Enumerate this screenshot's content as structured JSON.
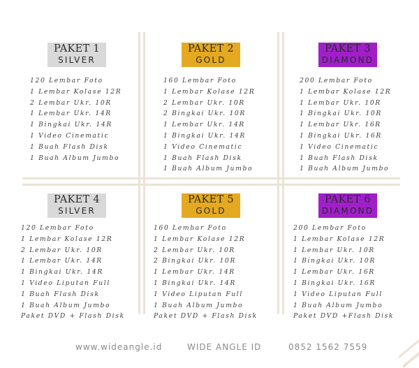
{
  "packages": [
    {
      "name": "PAKET 1",
      "tier": "SILVER",
      "items": [
        "120 Lembar Foto",
        "1 Lembar Kolase 12R",
        "2 Lembar Ukr. 10R",
        "1 Lembar Ukr. 14R",
        "1 Bingkai Ukr. 14R",
        "1 Video Cinematic",
        "1 Buah Flash Disk",
        "1 Buah Album Jumbo"
      ]
    },
    {
      "name": "PAKET 2",
      "tier": "GOLD",
      "items": [
        "160 Lembar Foto",
        "1 Lembar Kolase 12R",
        "2 Lembar Ukr. 10R",
        "2 Bingkai Ukr. 10R",
        "1 Lembar Ukr. 14R",
        "1 Bingkai Ukr. 14R",
        "1 Video Cinematic",
        "1 Buah Flash Disk",
        "1 Buah Album Jumbo"
      ]
    },
    {
      "name": "PAKET 3",
      "tier": "DIAMOND",
      "items": [
        "200 Lembar Foto",
        "1 Lembar Kolase 12R",
        "1 Lembar Ukr. 10R",
        "1 Bingkai Ukr. 10R",
        "1 Lembar Ukr. 16R",
        "1 Bingkai Ukr. 16R",
        "1 Video Cinematic",
        "1 Buah Flash Disk",
        "1 Buah Album Jumbo"
      ]
    },
    {
      "name": "PAKET 4",
      "tier": "SILVER",
      "items": [
        "120 Lembar Foto",
        "1 Lembar Kolase 12R",
        "2 Lembar Ukr. 10R",
        "1 Lembar Ukr. 14R",
        "1 Bingkai Ukr. 14R",
        "1 Video Liputan Full",
        "1 Buah Flash Disk",
        "1 Buah Album Jumbo",
        "Paket DVD + Flash Disk"
      ]
    },
    {
      "name": "PAKET 5",
      "tier": "GOLD",
      "items": [
        "160 Lembar Foto",
        "1 Lembar Kolase 12R",
        "2 Lembar Ukr. 10R",
        "2 Bingkai Ukr. 10R",
        "1 Lembar Ukr. 14R",
        "1 Bingkai Ukr. 14R",
        "1 Video Liputan Full",
        "1 Buah Album Jumbo",
        "Paket DVD + Flash Disk"
      ]
    },
    {
      "name": "PAKET 6",
      "tier": "DIAMOND",
      "items": [
        "200 Lembar Foto",
        "1 Lembar Kolase 12R",
        "1 Lembar Ukr. 10R",
        "1 Bingkai Ukr. 10R",
        "1 Lembar Ukr. 16R",
        "1 Bingkai Ukr. 16R",
        "1 Video Liputan Full",
        "1 Buah Album Jumbo",
        "Paket DVD +Flash Disk"
      ]
    }
  ],
  "footer": {
    "website": "www.wideangle.id",
    "brand": "WIDE ANGLE ID",
    "phone": "0852 1562 7559"
  },
  "colors": {
    "silver": "#d9d9d9",
    "gold": "#e4a920",
    "diamond": "#a01fc9",
    "divider": "#ece3d7"
  }
}
